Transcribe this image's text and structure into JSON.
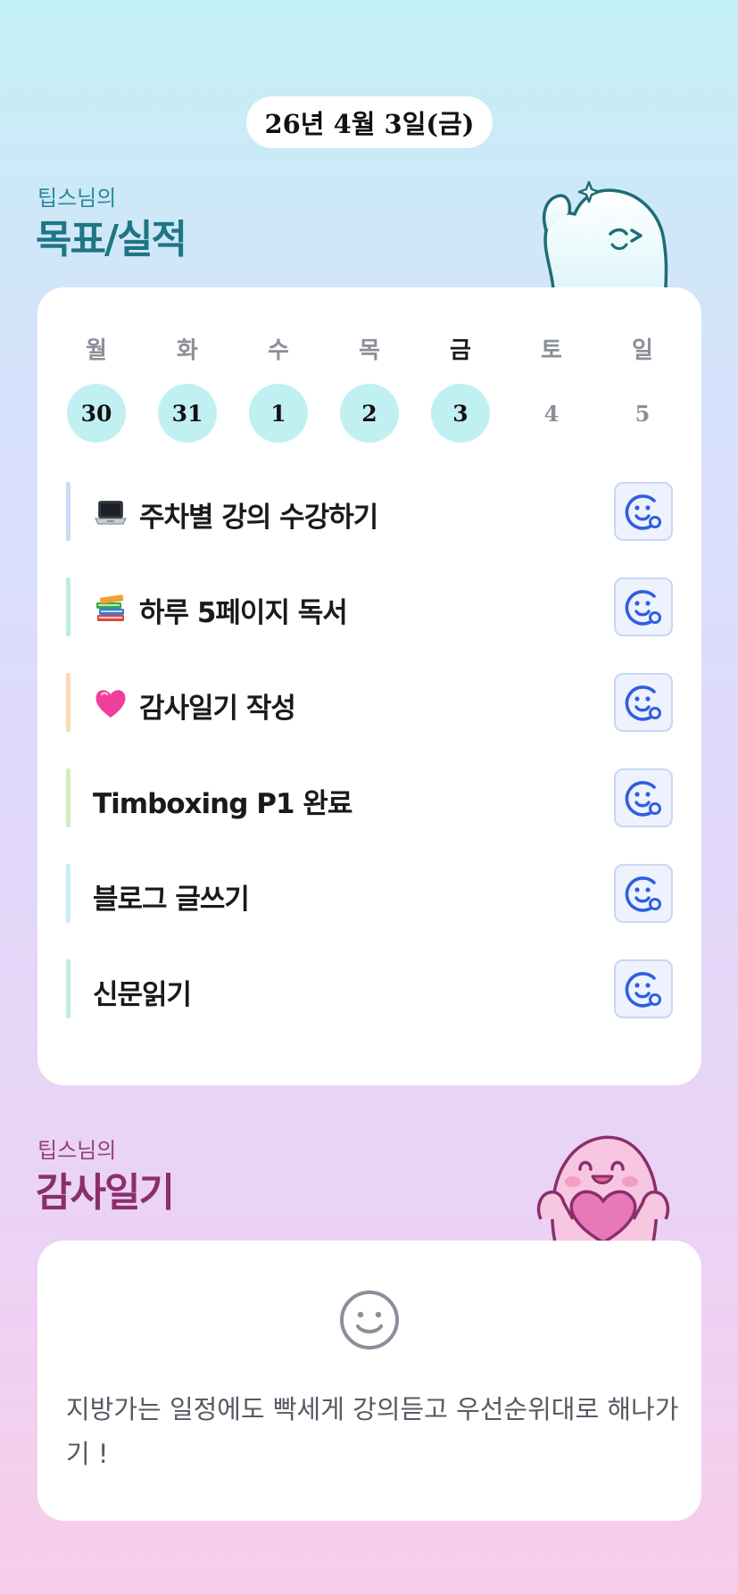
{
  "date": "26년 4월 3일(금)",
  "goals_section": {
    "subtitle": "팁스님의",
    "title": "목표/실적"
  },
  "week": {
    "days": [
      {
        "dow": "월",
        "num": "30",
        "filled": true,
        "today": false
      },
      {
        "dow": "화",
        "num": "31",
        "filled": true,
        "today": false
      },
      {
        "dow": "수",
        "num": "1",
        "filled": true,
        "today": false
      },
      {
        "dow": "목",
        "num": "2",
        "filled": true,
        "today": false
      },
      {
        "dow": "금",
        "num": "3",
        "filled": true,
        "today": true
      },
      {
        "dow": "토",
        "num": "4",
        "filled": false,
        "today": false
      },
      {
        "dow": "일",
        "num": "5",
        "filled": false,
        "today": false
      }
    ]
  },
  "goals": [
    {
      "label": "주차별 강의 수강하기",
      "icon": "laptop-icon",
      "bar_color": "#cfd9f7"
    },
    {
      "label": "하루 5페이지 독서",
      "icon": "books-icon",
      "bar_color": "#bdeed9"
    },
    {
      "label": "감사일기 작성",
      "icon": "heart-icon",
      "bar_color": "#fbdcb4"
    },
    {
      "label": "Timboxing P1 완료",
      "icon": "",
      "bar_color": "#cdeec0"
    },
    {
      "label": "블로그 글쓰기",
      "icon": "",
      "bar_color": "#c6eef4"
    },
    {
      "label": "신문읽기",
      "icon": "",
      "bar_color": "#bdeedd"
    }
  ],
  "thanks_section": {
    "subtitle": "팁스님의",
    "title": "감사일기"
  },
  "thanks": {
    "text": "지방가는 일정에도 빡세게 강의듣고 우선순위대로 해나가기 !"
  },
  "colors": {
    "accent_teal": "#1f7584",
    "accent_plum": "#8b2e6d",
    "check_blue": "#2f5fe0"
  }
}
